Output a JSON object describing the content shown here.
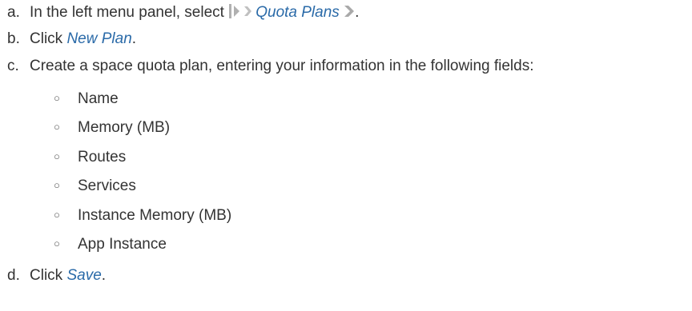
{
  "steps": [
    {
      "marker": "a.",
      "text_before": "In the left menu panel, select",
      "link": "Quota Plans",
      "text_after": "."
    },
    {
      "marker": "b.",
      "text_before": "Click",
      "link": "New Plan",
      "text_after": "."
    },
    {
      "marker": "c.",
      "text": "Create a space quota plan, entering your information in the following fields:",
      "fields": [
        "Name",
        "Memory (MB)",
        "Routes",
        "Services",
        "Instance Memory (MB)",
        "App Instance"
      ]
    },
    {
      "marker": "d.",
      "text_before": "Click",
      "link": "Save",
      "text_after": "."
    }
  ],
  "bullet_glyph": "○",
  "colors": {
    "text": "#333333",
    "link": "#2a6aa8",
    "icon_gray": "#b0b0b0"
  },
  "icons": [
    "menu-expand-icon",
    "chevron-right-icon",
    "chevron-right-icon"
  ]
}
